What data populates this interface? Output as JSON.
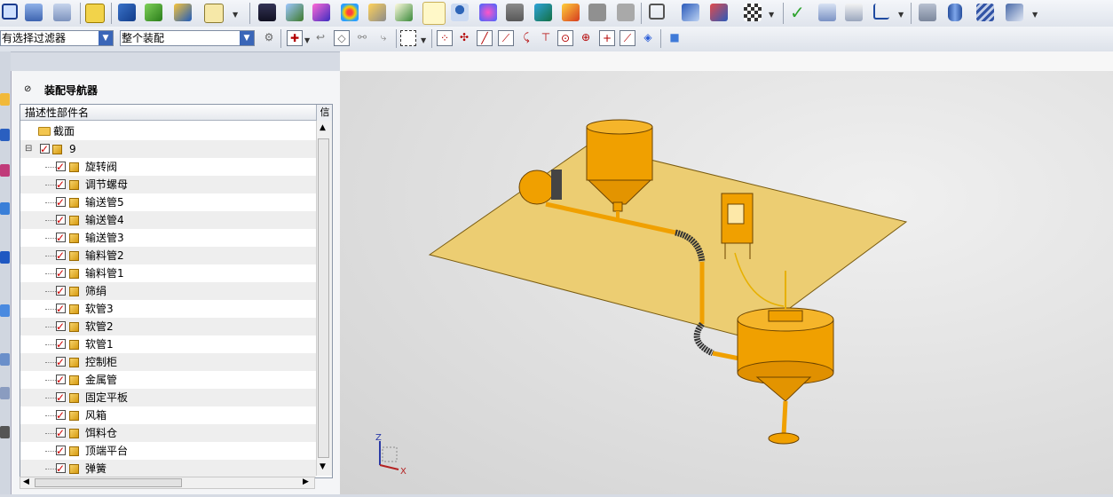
{
  "toolbar": {
    "filter_value": "有选择过滤器",
    "scope_value": "整个装配"
  },
  "navigator": {
    "title": "装配导航器",
    "column_header": "描述性部件名",
    "column_header_2": "信",
    "section_label": "截面",
    "root_label": "9",
    "items": [
      "旋转阀",
      "调节螺母",
      "输送管5",
      "输送管4",
      "输送管3",
      "输料管2",
      "输料管1",
      "筛绢",
      "软管3",
      "软管2",
      "软管1",
      "控制柜",
      "金属管",
      "固定平板",
      "风箱",
      "饵料仓",
      "顶端平台",
      "弹簧"
    ]
  },
  "triad": {
    "z_label": "Z",
    "x_label": "X"
  },
  "colors": {
    "model": "#f0a000",
    "plate": "#eccd72",
    "accent": "#d00000"
  }
}
